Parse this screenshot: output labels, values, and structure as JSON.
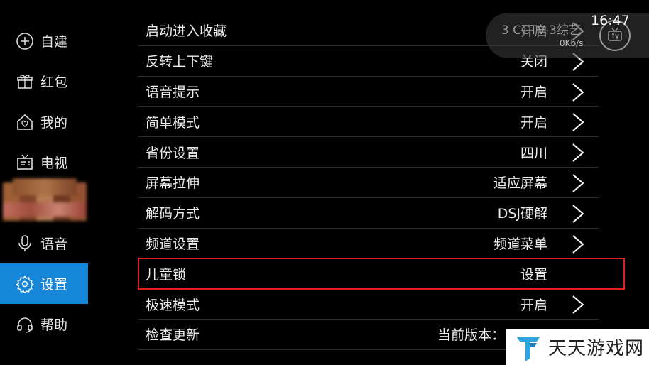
{
  "sidebar": {
    "items": [
      {
        "label": "自建",
        "icon": "plus-circle-icon"
      },
      {
        "label": "红包",
        "icon": "gift-icon"
      },
      {
        "label": "我的",
        "icon": "home-heart-icon"
      },
      {
        "label": "电视",
        "icon": "tv-icon"
      },
      {
        "label": "语音",
        "icon": "microphone-icon"
      },
      {
        "label": "设置",
        "icon": "gear-icon",
        "active": true
      },
      {
        "label": "帮助",
        "icon": "headset-icon"
      }
    ]
  },
  "settings": {
    "rows": [
      {
        "label": "启动进入收藏",
        "value": "开启",
        "chevron": true
      },
      {
        "label": "反转上下键",
        "value": "关闭",
        "chevron": true
      },
      {
        "label": "语音提示",
        "value": "开启",
        "chevron": true
      },
      {
        "label": "简单模式",
        "value": "开启",
        "chevron": true
      },
      {
        "label": "省份设置",
        "value": "四川",
        "chevron": true
      },
      {
        "label": "屏幕拉伸",
        "value": "适应屏幕",
        "chevron": true
      },
      {
        "label": "解码方式",
        "value": "DSJ硬解",
        "chevron": true
      },
      {
        "label": "频道设置",
        "value": "频道菜单",
        "chevron": true
      },
      {
        "label": "儿童锁",
        "value": "设置",
        "chevron": false,
        "highlight": true
      },
      {
        "label": "极速模式",
        "value": "开启",
        "chevron": true
      },
      {
        "label": "检查更新",
        "value": "当前版本：",
        "chevron": false
      }
    ]
  },
  "overlay": {
    "channel": "3  CCTV-3综艺",
    "speed": "0Kb/s",
    "time": "16:47"
  },
  "watermark": {
    "text": "天天游戏网"
  },
  "colors": {
    "active_bg": "#1686d9",
    "highlight_border": "#e01e1e",
    "background": "#000000"
  }
}
